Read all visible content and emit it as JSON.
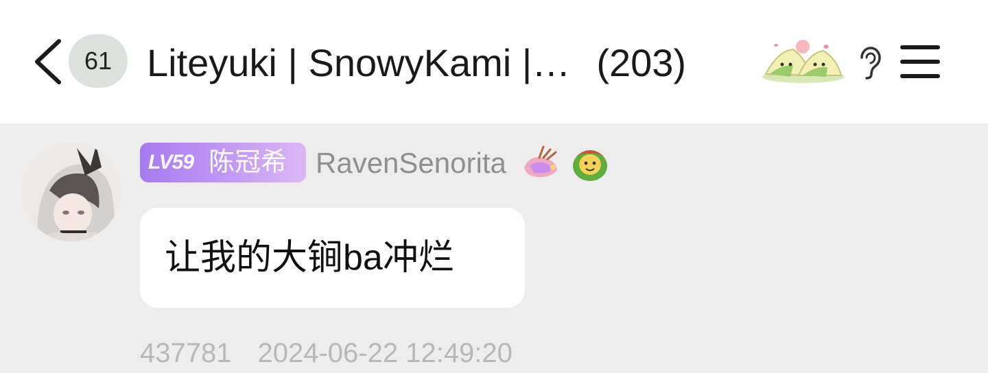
{
  "header": {
    "unread_count": "61",
    "chat_title": "Liteyuki | SnowyKami |…",
    "member_count": "(203)"
  },
  "message": {
    "level": "LV59",
    "member_title": "陈冠希",
    "username": "RavenSenorita",
    "text": "让我的大锏ba冲烂",
    "id": "437781",
    "timestamp": "2024-06-22 12:49:20"
  },
  "icons": {
    "back": "chevron-left-icon",
    "sticker": "zongzi-sticker",
    "listen": "ear-icon",
    "menu": "hamburger-menu-icon",
    "badge1": "lantern-icon",
    "badge2": "green-face-icon"
  },
  "colors": {
    "level_gradient_start": "#a77bf0",
    "level_gradient_end": "#dcb7f5",
    "page_background": "#ededed",
    "bubble_background": "#ffffff"
  }
}
